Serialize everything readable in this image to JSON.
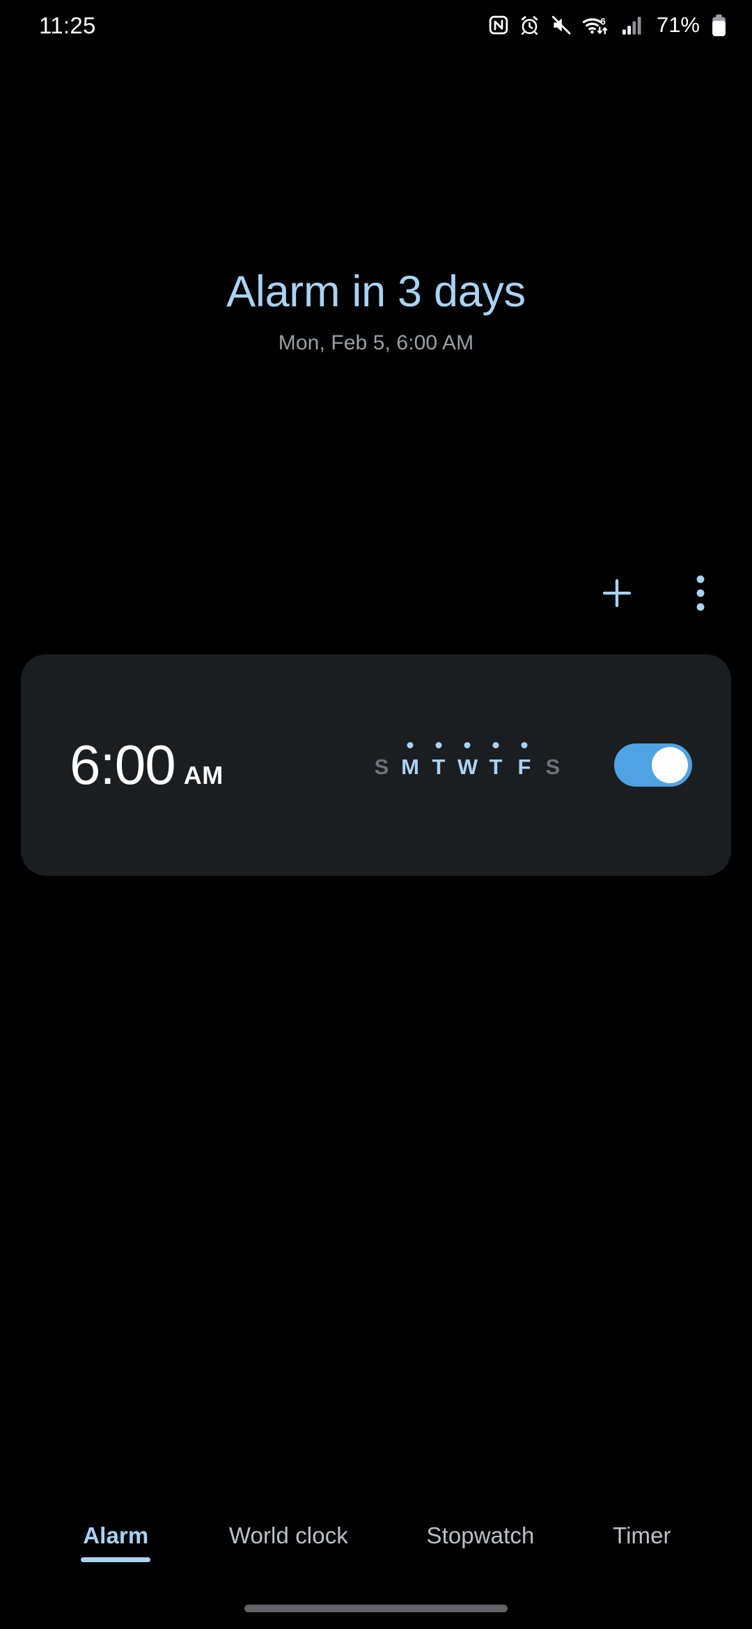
{
  "status_bar": {
    "time": "11:25",
    "battery_percent": "71%",
    "wifi_generation": "6",
    "icons": [
      "nfc-icon",
      "alarm-clock-icon",
      "mute-icon",
      "wifi-icon",
      "cellular-signal-icon",
      "battery-icon"
    ]
  },
  "header": {
    "title": "Alarm in 3 days",
    "subtitle": "Mon, Feb 5, 6:00 AM"
  },
  "actions": {
    "add_label": "+",
    "overflow_label": "More options"
  },
  "alarm": {
    "time": "6:00",
    "meridiem": "AM",
    "days": [
      {
        "letter": "S",
        "active": false
      },
      {
        "letter": "M",
        "active": true
      },
      {
        "letter": "T",
        "active": true
      },
      {
        "letter": "W",
        "active": true
      },
      {
        "letter": "T",
        "active": true
      },
      {
        "letter": "F",
        "active": true
      },
      {
        "letter": "S",
        "active": false
      }
    ],
    "enabled": true
  },
  "tabs": [
    {
      "label": "Alarm",
      "active": true
    },
    {
      "label": "World clock",
      "active": false
    },
    {
      "label": "Stopwatch",
      "active": false
    },
    {
      "label": "Timer",
      "active": false
    }
  ],
  "colors": {
    "accent": "#A9D3F5",
    "toggle_on": "#4FA3E3",
    "card_bg": "#1B1E21",
    "background": "#000000",
    "muted_text": "#9BA0A5"
  }
}
